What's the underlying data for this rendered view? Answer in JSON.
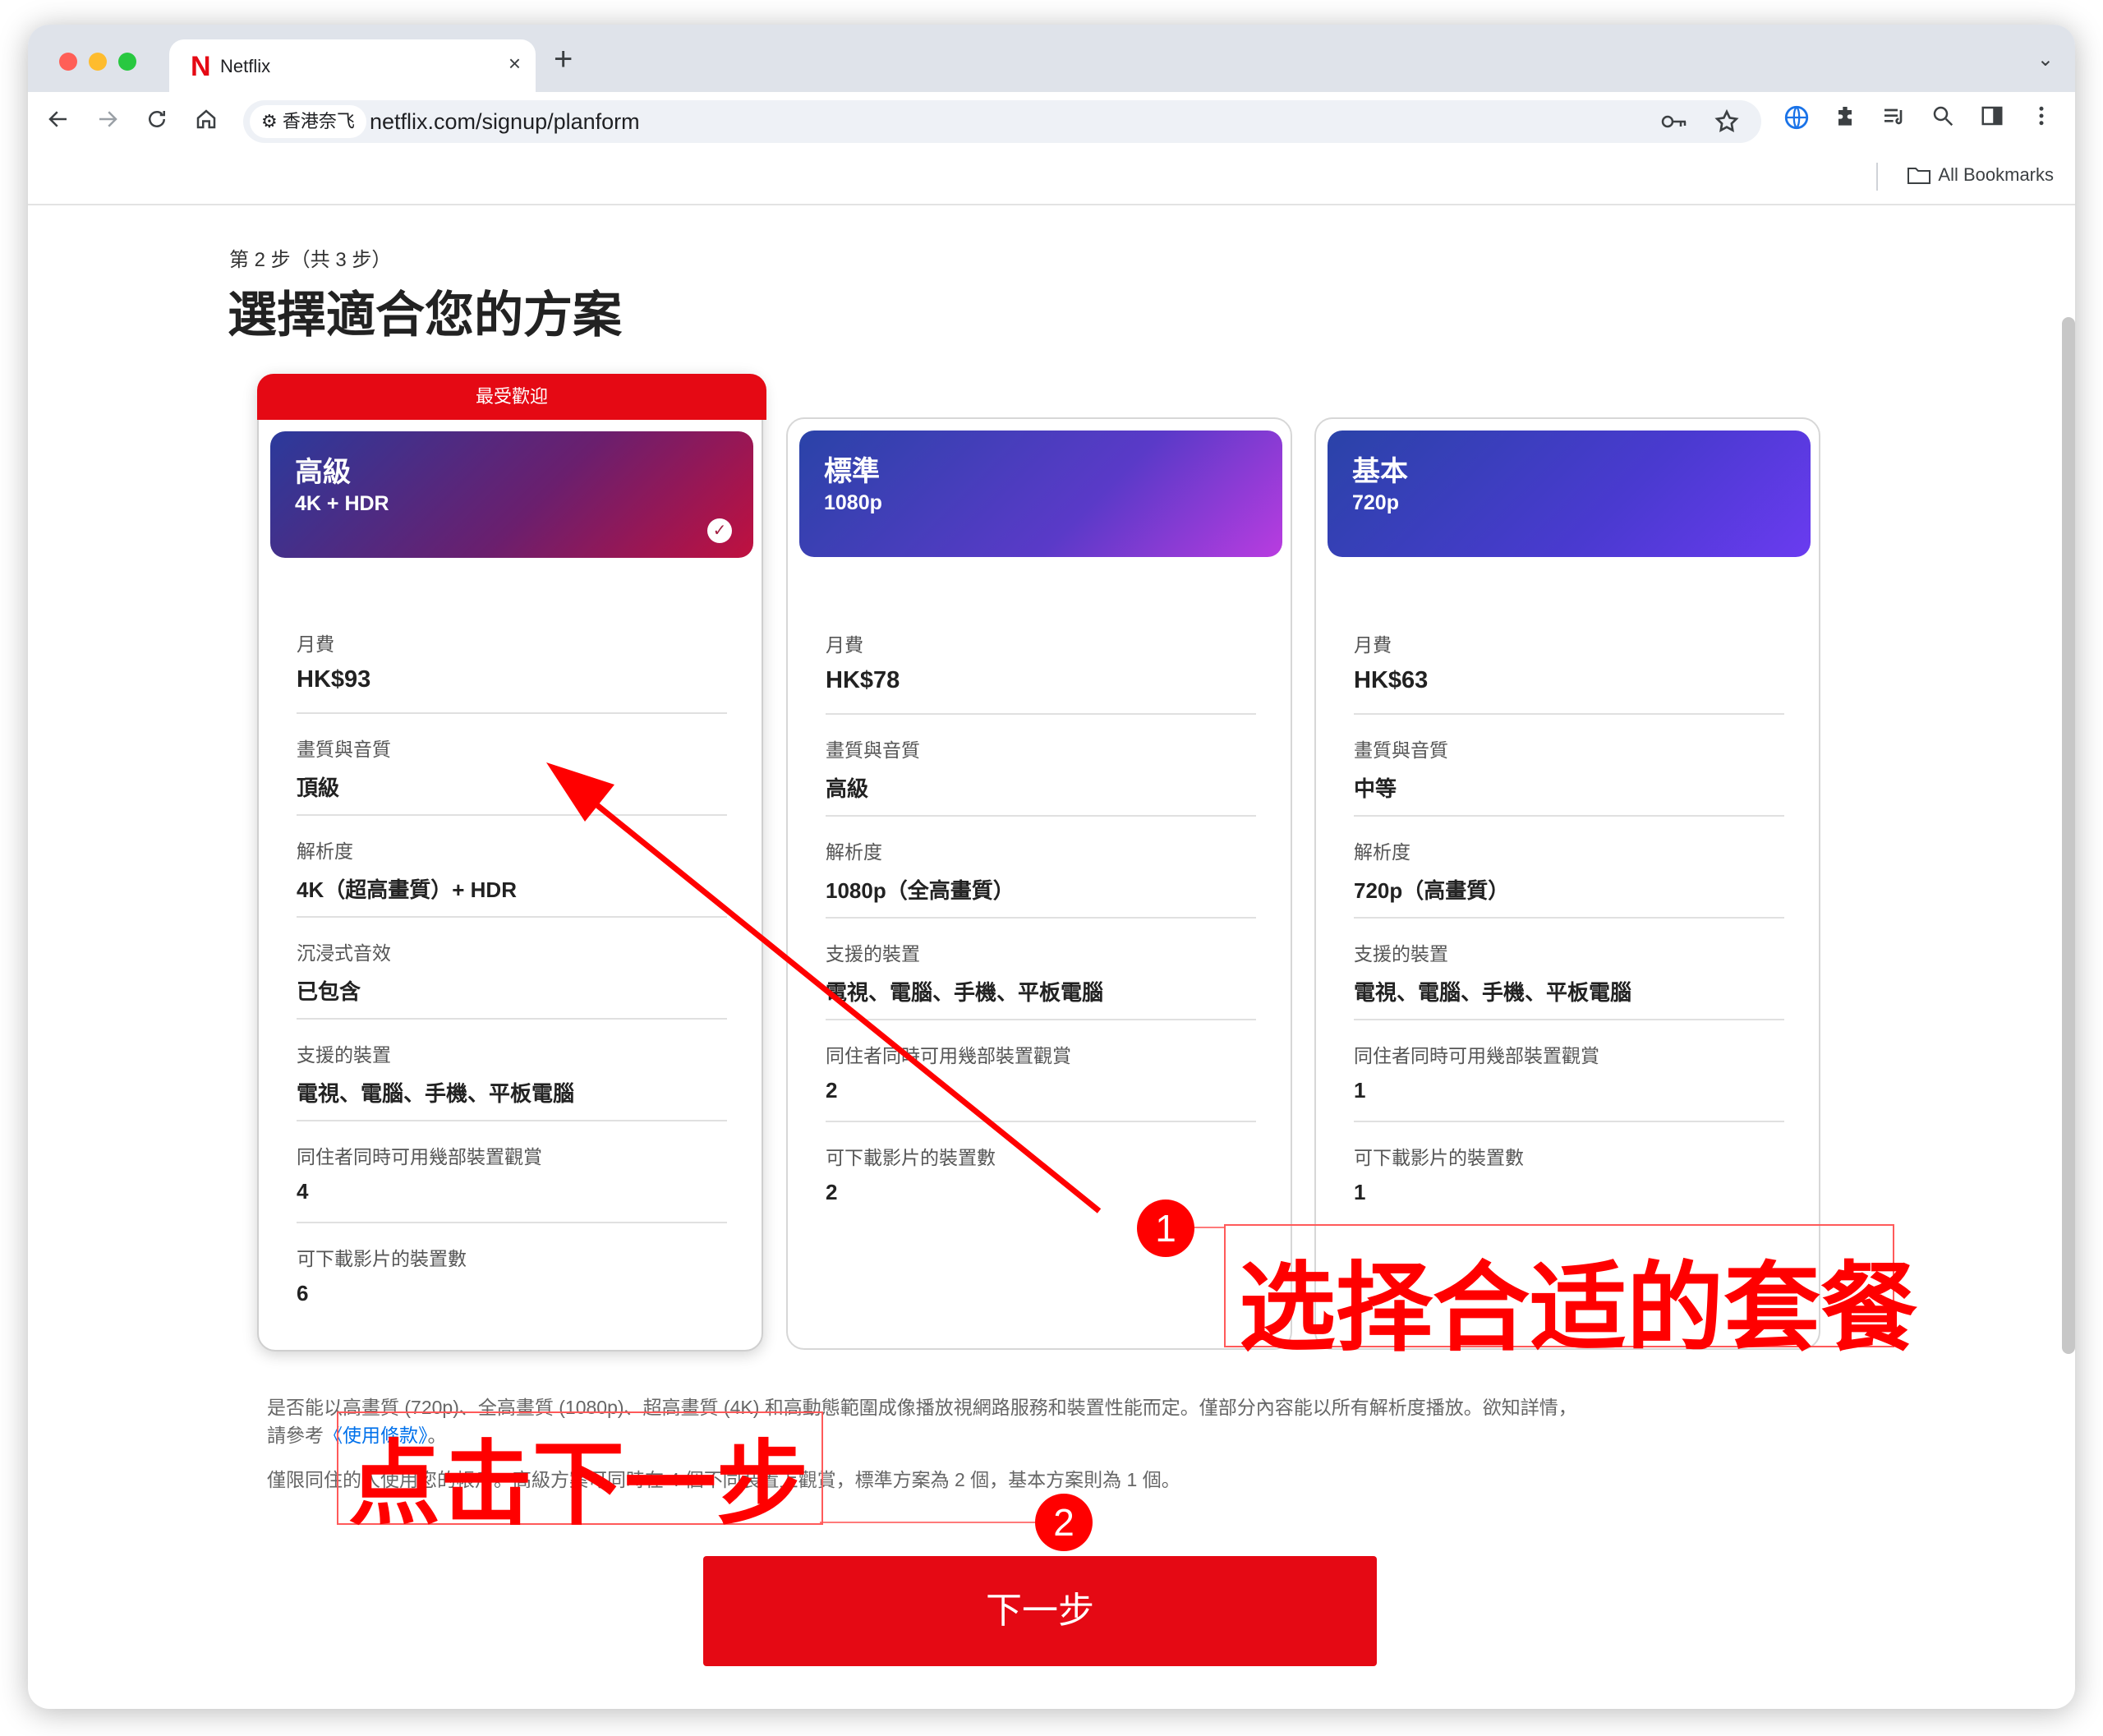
{
  "browser": {
    "tab_title": "Netflix",
    "tab_logo": "N",
    "tab_close": "×",
    "new_tab": "+",
    "tab_menu": "⌄",
    "site_label": "香港奈飞",
    "url": "netflix.com/signup/planform",
    "bookmarks_label": "All Bookmarks",
    "icons": [
      "back-icon",
      "forward-icon",
      "reload-icon",
      "home-icon",
      "site-info-icon",
      "key-icon",
      "star-icon",
      "translate-icon",
      "extensions-icon",
      "reading-list-icon",
      "search-icon",
      "side-panel-icon",
      "menu-icon",
      "folder-icon"
    ]
  },
  "page": {
    "step": "第 2 步（共 3 步）",
    "title": "選擇適合您的方案",
    "popular_badge": "最受歡迎"
  },
  "plans": [
    {
      "name": "高級",
      "resolution": "4K + HDR",
      "selected": true,
      "rows": [
        {
          "label": "月費",
          "value": "HK$93"
        },
        {
          "label": "畫質與音質",
          "value": "頂級"
        },
        {
          "label": "解析度",
          "value": "4K（超高畫質）+ HDR"
        },
        {
          "label": "沉浸式音效",
          "value": "已包含"
        },
        {
          "label": "支援的裝置",
          "value": "電視、電腦、手機、平板電腦"
        },
        {
          "label": "同住者同時可用幾部裝置觀賞",
          "value": "4"
        },
        {
          "label": "可下載影片的裝置數",
          "value": "6"
        }
      ]
    },
    {
      "name": "標準",
      "resolution": "1080p",
      "selected": false,
      "rows": [
        {
          "label": "月費",
          "value": "HK$78"
        },
        {
          "label": "畫質與音質",
          "value": "高級"
        },
        {
          "label": "解析度",
          "value": "1080p（全高畫質）"
        },
        {
          "label": "支援的裝置",
          "value": "電視、電腦、手機、平板電腦"
        },
        {
          "label": "同住者同時可用幾部裝置觀賞",
          "value": "2"
        },
        {
          "label": "可下載影片的裝置數",
          "value": "2"
        }
      ]
    },
    {
      "name": "基本",
      "resolution": "720p",
      "selected": false,
      "rows": [
        {
          "label": "月費",
          "value": "HK$63"
        },
        {
          "label": "畫質與音質",
          "value": "中等"
        },
        {
          "label": "解析度",
          "value": "720p（高畫質）"
        },
        {
          "label": "支援的裝置",
          "value": "電視、電腦、手機、平板電腦"
        },
        {
          "label": "同住者同時可用幾部裝置觀賞",
          "value": "1"
        },
        {
          "label": "可下載影片的裝置數",
          "value": "1"
        }
      ]
    }
  ],
  "footnotes": {
    "line1": "是否能以高畫質 (720p)、全高畫質 (1080p)、超高畫質 (4K) 和高動態範圍成像播放視網路服務和裝置性能而定。僅部分內容能以所有解析度播放。欲知詳情，",
    "line2_prefix": "請參考",
    "terms_link": "《使用條款》",
    "line2_suffix": "。",
    "line3": "僅限同住的人使用您的帳戶。高級方案可同時在 4 個不同裝置上觀賞，標準方案為 2 個，基本方案則為 1 個。"
  },
  "next_button": "下一步",
  "annotations": {
    "callout1_text": "选择合适的套餐",
    "callout1_number": "1",
    "callout2_text": "点击下一步",
    "callout2_number": "2",
    "color": "#ff0000"
  },
  "colors": {
    "netflix_red": "#e50914",
    "premium_gradient": [
      "#2b3a9c",
      "#c0103f"
    ],
    "standard_gradient": [
      "#2a43a8",
      "#b93ce0"
    ],
    "basic_gradient": [
      "#2a43a8",
      "#6a3bf0"
    ]
  }
}
